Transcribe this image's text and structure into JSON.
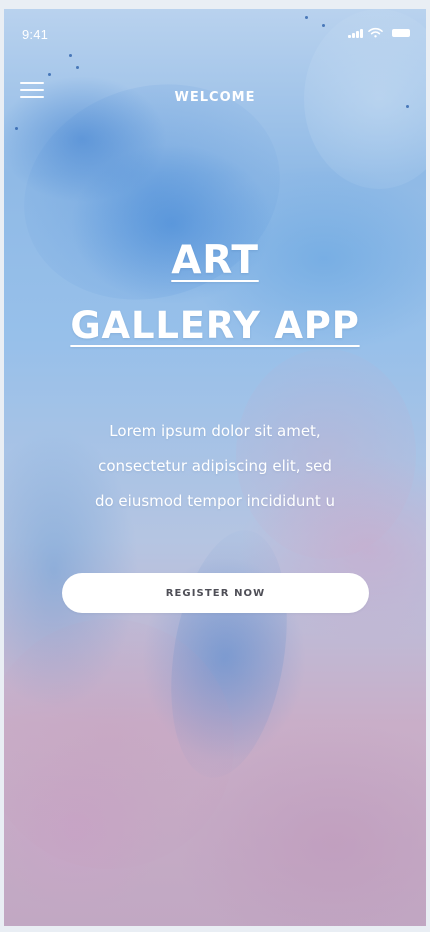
{
  "status_bar": {
    "time": "9:41",
    "icons": [
      "signal-icon",
      "wifi-icon",
      "battery-icon"
    ]
  },
  "header": {
    "menu_icon": "menu-icon",
    "title": "WELCOME"
  },
  "hero": {
    "title_line_1": "ART",
    "title_line_2": "GALLERY APP",
    "body_lines": [
      "Lorem ipsum dolor sit amet,",
      "consectetur adipiscing elit, sed",
      "do eiusmod tempor incididunt u"
    ]
  },
  "actions": {
    "register_label": "REGISTER NOW"
  },
  "colors": {
    "text": "#ffffff",
    "button_background": "#ffffff",
    "button_text": "#4f4f57",
    "background_blue": "#90bae6",
    "background_pink": "#c9aec8"
  }
}
